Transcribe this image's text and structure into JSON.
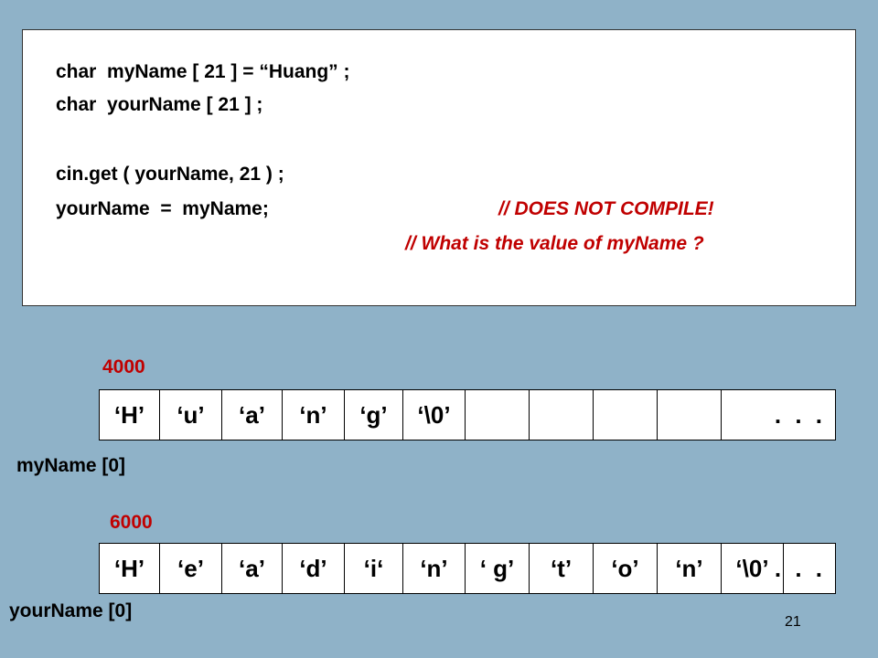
{
  "code": {
    "line1": "char  myName [ 21 ] = “Huang” ;",
    "line2": "char  yourName [ 21 ] ;",
    "line3": "cin.get ( yourName, 21 ) ;",
    "line4": "yourName  =  myName;",
    "comment1": "// DOES NOT COMPILE!",
    "comment2": "// What is the value of myName ?"
  },
  "my_name_array": {
    "address": "4000",
    "label": "myName [0]",
    "cells": [
      "‘H’",
      "‘u’",
      "‘a’",
      "‘n’",
      "‘g’",
      "‘\\0’",
      "",
      "",
      "",
      "",
      ". . ."
    ]
  },
  "your_name_array": {
    "address": "6000",
    "label": "yourName [0]",
    "cells": [
      "‘H’",
      "‘e’",
      "‘a’",
      "‘d’",
      "‘i‘",
      "‘n’",
      "‘ g’",
      "‘t’",
      "‘o’",
      "‘n’",
      "‘\\0’",
      ". . ."
    ]
  },
  "slide_number": "21",
  "colors": {
    "background": "#8fb2c8",
    "accent_red": "#c00000"
  }
}
